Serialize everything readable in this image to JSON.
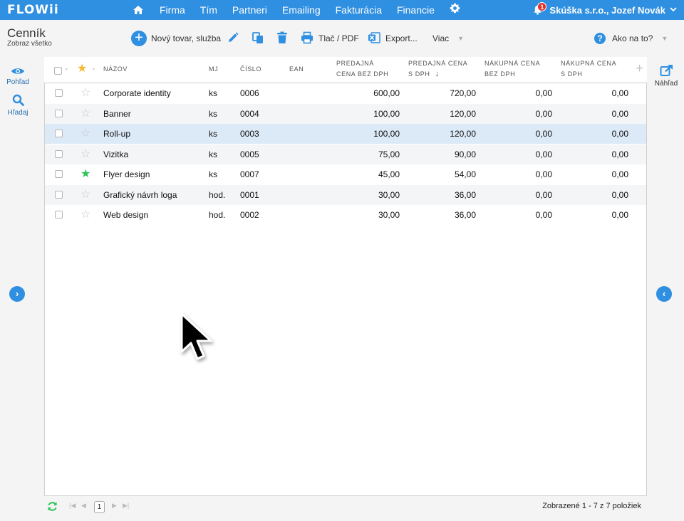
{
  "app": {
    "logo": "FLOWii"
  },
  "nav": {
    "items": [
      "Firma",
      "Tím",
      "Partneri",
      "Emailing",
      "Fakturácia",
      "Financie"
    ],
    "notification_count": "1",
    "user": "Skúška s.r.o., Jozef Novák"
  },
  "toolbar": {
    "title": "Cenník",
    "subtitle": "Zobraz všetko",
    "new_item": "Nový tovar, služba",
    "print": "Tlač / PDF",
    "export": "Export...",
    "more": "Viac",
    "help": "Ako na to?"
  },
  "left_panel": {
    "view": "Pohľad",
    "search": "Hľadaj"
  },
  "right_panel": {
    "preview": "Náhľad"
  },
  "columns": {
    "name": "Názov",
    "unit": "MJ",
    "number": "Číslo",
    "ean": "EAN",
    "sale_net_1": "Predajná",
    "sale_net_2": "cena bez DPH",
    "sale_gross_1": "Predajná cena",
    "sale_gross_2": "s DPH",
    "buy_net_1": "Nákupná cena",
    "buy_net_2": "bez DPH",
    "buy_gross_1": "Nákupná cena",
    "buy_gross_2": "s DPH"
  },
  "rows": [
    {
      "starred": false,
      "name": "Corporate identity",
      "unit": "ks",
      "number": "0006",
      "ean": "",
      "sale_net": "600,00",
      "sale_gross": "720,00",
      "buy_net": "0,00",
      "buy_gross": "0,00"
    },
    {
      "starred": false,
      "name": "Banner",
      "unit": "ks",
      "number": "0004",
      "ean": "",
      "sale_net": "100,00",
      "sale_gross": "120,00",
      "buy_net": "0,00",
      "buy_gross": "0,00"
    },
    {
      "starred": false,
      "name": "Roll-up",
      "unit": "ks",
      "number": "0003",
      "ean": "",
      "sale_net": "100,00",
      "sale_gross": "120,00",
      "buy_net": "0,00",
      "buy_gross": "0,00"
    },
    {
      "starred": false,
      "name": "Vizitka",
      "unit": "ks",
      "number": "0005",
      "ean": "",
      "sale_net": "75,00",
      "sale_gross": "90,00",
      "buy_net": "0,00",
      "buy_gross": "0,00"
    },
    {
      "starred": true,
      "name": "Flyer design",
      "unit": "ks",
      "number": "0007",
      "ean": "",
      "sale_net": "45,00",
      "sale_gross": "54,00",
      "buy_net": "0,00",
      "buy_gross": "0,00"
    },
    {
      "starred": false,
      "name": "Grafický návrh loga",
      "unit": "hod.",
      "number": "0001",
      "ean": "",
      "sale_net": "30,00",
      "sale_gross": "36,00",
      "buy_net": "0,00",
      "buy_gross": "0,00"
    },
    {
      "starred": false,
      "name": "Web design",
      "unit": "hod.",
      "number": "0002",
      "ean": "",
      "sale_net": "30,00",
      "sale_gross": "36,00",
      "buy_net": "0,00",
      "buy_gross": "0,00"
    }
  ],
  "pager": {
    "page": "1",
    "info": "Zobrazené 1 - 7 z 7 položiek"
  },
  "colors": {
    "accent": "#2f8fe0",
    "star_active": "#2ec35a",
    "star_header": "#f5b731",
    "selected_row": "#dce9f7"
  },
  "icons": [
    "home-icon",
    "gear-icon",
    "bell-icon",
    "pencil-icon",
    "copy-icon",
    "trash-icon",
    "printer-icon",
    "excel-icon",
    "help-icon",
    "eye-icon",
    "search-icon",
    "external-link-icon",
    "refresh-icon"
  ]
}
